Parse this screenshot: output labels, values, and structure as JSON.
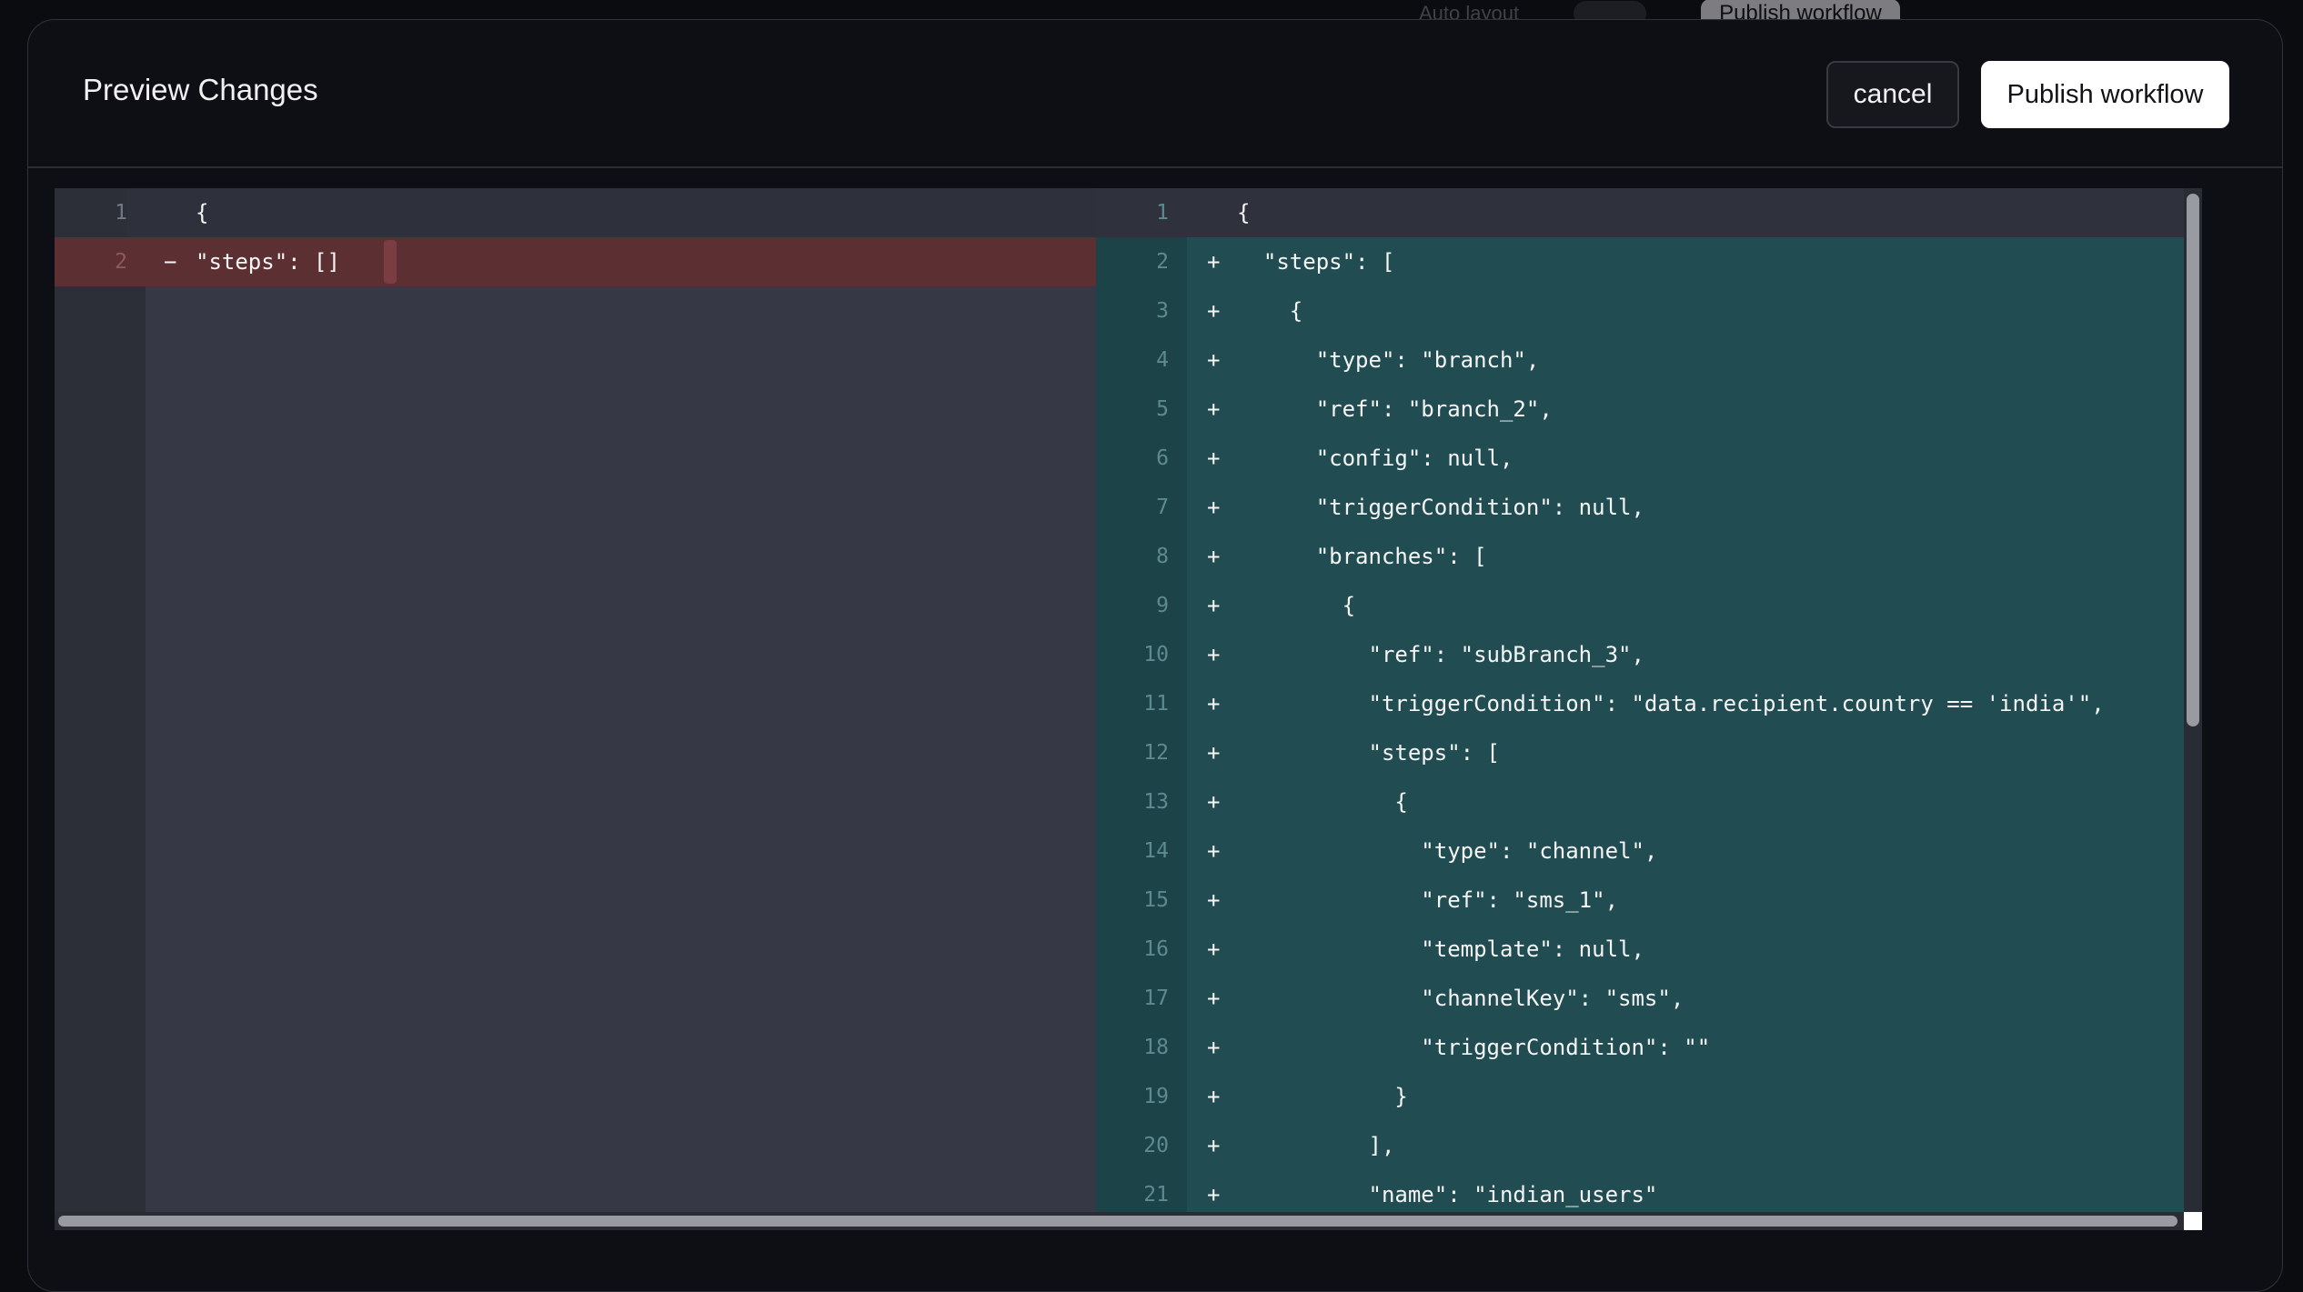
{
  "background_toolbar": {
    "item1": "Auto layout",
    "publish_label": "Publish workflow"
  },
  "modal": {
    "title": "Preview Changes",
    "cancel_label": "cancel",
    "publish_label": "Publish workflow"
  },
  "diff": {
    "left": [
      {
        "num": "1",
        "marker": "",
        "code": "{",
        "type": "context"
      },
      {
        "num": "2",
        "marker": "−",
        "code": "\"steps\": []",
        "type": "removed"
      }
    ],
    "right": [
      {
        "num": "1",
        "marker": "",
        "code": "{",
        "type": "context"
      },
      {
        "num": "2",
        "marker": "+",
        "code": "  \"steps\": [",
        "type": "added"
      },
      {
        "num": "3",
        "marker": "+",
        "code": "    {",
        "type": "added"
      },
      {
        "num": "4",
        "marker": "+",
        "code": "      \"type\": \"branch\",",
        "type": "added"
      },
      {
        "num": "5",
        "marker": "+",
        "code": "      \"ref\": \"branch_2\",",
        "type": "added"
      },
      {
        "num": "6",
        "marker": "+",
        "code": "      \"config\": null,",
        "type": "added"
      },
      {
        "num": "7",
        "marker": "+",
        "code": "      \"triggerCondition\": null,",
        "type": "added"
      },
      {
        "num": "8",
        "marker": "+",
        "code": "      \"branches\": [",
        "type": "added"
      },
      {
        "num": "9",
        "marker": "+",
        "code": "        {",
        "type": "added"
      },
      {
        "num": "10",
        "marker": "+",
        "code": "          \"ref\": \"subBranch_3\",",
        "type": "added"
      },
      {
        "num": "11",
        "marker": "+",
        "code": "          \"triggerCondition\": \"data.recipient.country == 'india'\",",
        "type": "added"
      },
      {
        "num": "12",
        "marker": "+",
        "code": "          \"steps\": [",
        "type": "added"
      },
      {
        "num": "13",
        "marker": "+",
        "code": "            {",
        "type": "added"
      },
      {
        "num": "14",
        "marker": "+",
        "code": "              \"type\": \"channel\",",
        "type": "added"
      },
      {
        "num": "15",
        "marker": "+",
        "code": "              \"ref\": \"sms_1\",",
        "type": "added"
      },
      {
        "num": "16",
        "marker": "+",
        "code": "              \"template\": null,",
        "type": "added"
      },
      {
        "num": "17",
        "marker": "+",
        "code": "              \"channelKey\": \"sms\",",
        "type": "added"
      },
      {
        "num": "18",
        "marker": "+",
        "code": "              \"triggerCondition\": \"\"",
        "type": "added"
      },
      {
        "num": "19",
        "marker": "+",
        "code": "            }",
        "type": "added"
      },
      {
        "num": "20",
        "marker": "+",
        "code": "          ],",
        "type": "added"
      },
      {
        "num": "21",
        "marker": "+",
        "code": "          \"name\": \"indian_users\"",
        "type": "added"
      }
    ]
  },
  "colors": {
    "removed_bg": "#5c3033",
    "added_bg": "#214d52",
    "context_bg": "#363845"
  }
}
